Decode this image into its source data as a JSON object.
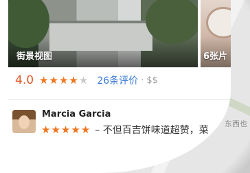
{
  "map": {
    "road_label": "东西也"
  },
  "photos": {
    "main_label": "街景视图",
    "side_label": "6张片"
  },
  "place": {
    "rating": "4.0",
    "stars_filled": 4,
    "stars_total": 5,
    "reviews_link": "26条评价",
    "price": "· $$"
  },
  "review": {
    "reviewer_name": "Marcia Garcia",
    "stars_filled": 5,
    "text": "– 不但百吉饼味道超赞，菜"
  },
  "colors": {
    "accent_orange": "#f0751e",
    "rating_orange": "#e0592a",
    "link_blue": "#3d7bd6"
  }
}
